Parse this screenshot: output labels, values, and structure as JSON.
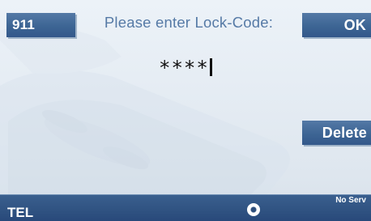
{
  "softkeys": {
    "left_top": "911",
    "right_top": "OK",
    "right_mid": "Delete"
  },
  "prompt": "Please enter Lock-Code:",
  "code_entry": {
    "value": "****"
  },
  "status_bar": {
    "mode": "TEL",
    "network": "No Serv"
  },
  "colors": {
    "accent": "#3d6594",
    "prompt_text": "#567aa6",
    "background": "#e6edf4"
  },
  "icons": {
    "background": "phone-watermark-icon",
    "status_center": "rotary-knob-icon"
  }
}
